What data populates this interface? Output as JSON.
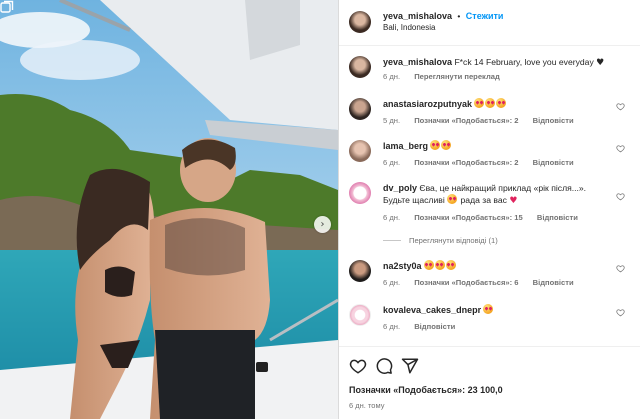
{
  "post": {
    "username": "yeva_mishalova",
    "separator": "•",
    "follow_label": "Стежити",
    "location": "Bali, Indonesia"
  },
  "caption": {
    "username": "yeva_mishalova",
    "text": "F*ck 14 February, love you everyday",
    "age": "6 дн.",
    "translate_label": "Переглянути переклад"
  },
  "comments": [
    {
      "username": "anastasiarozputnyak",
      "text": "",
      "emoji_count": 3,
      "age": "5 дн.",
      "likes": "Позначки «Подобається»: 2",
      "reply": "Відповісти"
    },
    {
      "username": "lama_berg",
      "text": "",
      "emoji_count": 2,
      "age": "6 дн.",
      "likes": "Позначки «Подобається»: 2",
      "reply": "Відповісти"
    },
    {
      "username": "dv_poly",
      "text_a": "Єва, це найкращий приклад «рік після...». Будьте щасливі",
      "text_b": "рада за вас",
      "age": "6 дн.",
      "likes": "Позначки «Подобається»: 15",
      "reply": "Відповісти"
    },
    {
      "username": "na2sty0a",
      "text": "",
      "emoji_count": 3,
      "age": "6 дн.",
      "likes": "Позначки «Подобається»: 6",
      "reply": "Відповісти"
    },
    {
      "username": "kovaleva_cakes_dnepr",
      "text": "",
      "emoji_count": 1,
      "age": "6 дн.",
      "likes": "",
      "reply": "Відповісти"
    }
  ],
  "view_replies_label": "Переглянути відповіді (1)",
  "footer": {
    "likes_label": "Позначки «Подобається»: 23 100,0",
    "age": "6 дн. тому"
  },
  "colors": {
    "accent": "#0095f6",
    "text": "#262626",
    "muted": "#737373",
    "heart": "#e0245e"
  },
  "icons": [
    "heart-icon",
    "comment-icon",
    "share-icon",
    "chevron-right-icon",
    "carousel-icon"
  ]
}
